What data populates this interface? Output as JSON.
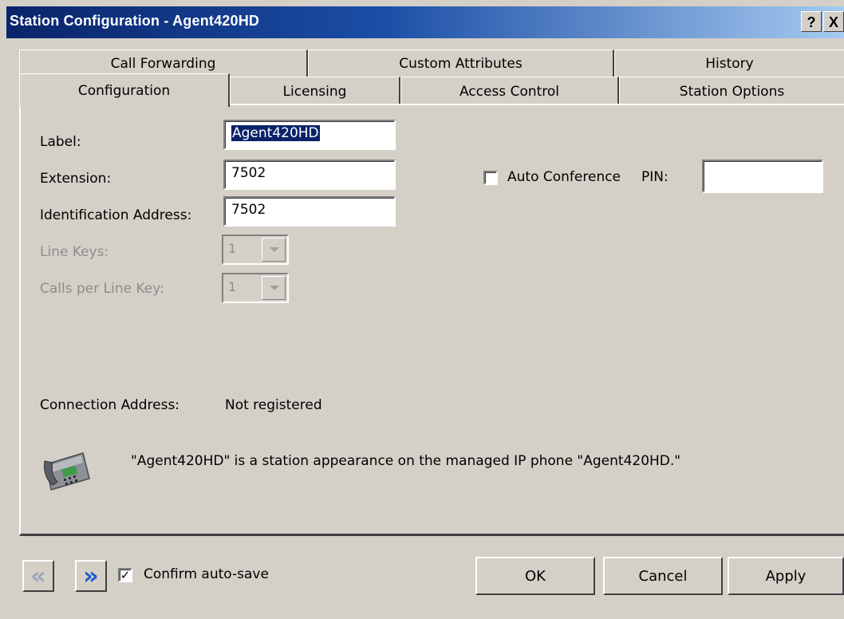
{
  "window": {
    "title": "Station Configuration - Agent420HD",
    "help_glyph": "?",
    "close_glyph": "X"
  },
  "tabs": {
    "back_row": [
      {
        "label": "Call Forwarding"
      },
      {
        "label": "Custom Attributes"
      },
      {
        "label": "History"
      }
    ],
    "front_row": [
      {
        "label": "Configuration",
        "active": true
      },
      {
        "label": "Licensing"
      },
      {
        "label": "Access Control"
      },
      {
        "label": "Station Options"
      }
    ]
  },
  "form": {
    "label_label": "Label:",
    "label_value": "Agent420HD",
    "extension_label": "Extension:",
    "extension_value": "7502",
    "identification_label": "Identification Address:",
    "identification_value": "7502",
    "line_keys_label": "Line Keys:",
    "line_keys_value": "1",
    "calls_per_line_label": "Calls per Line Key:",
    "calls_per_line_value": "1",
    "auto_conference_label": "Auto Conference",
    "auto_conference_checked": false,
    "pin_label": "PIN:",
    "pin_value": "",
    "connection_address_label": "Connection Address:",
    "connection_address_value": "Not registered",
    "info_message": "\"Agent420HD\" is a station appearance on the managed IP phone \"Agent420HD.\""
  },
  "footer": {
    "prev_glyph": "«",
    "next_glyph": "»",
    "confirm_autosave_label": "Confirm auto-save",
    "confirm_autosave_checked": true,
    "checkmark": "✓",
    "ok_label": "OK",
    "cancel_label": "Cancel",
    "apply_label": "Apply"
  },
  "colors": {
    "titlebar_start": "#0a246a",
    "face": "#d4d0c8",
    "selection": "#0a246a",
    "nav_next": "#1f56d4",
    "nav_prev_disabled": "#9fa6b8"
  }
}
